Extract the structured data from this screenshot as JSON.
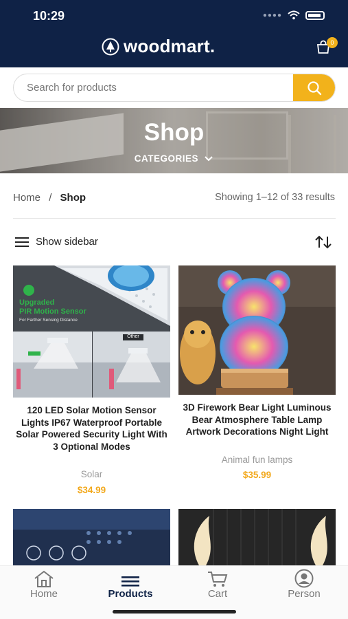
{
  "status": {
    "time": "10:29"
  },
  "brand": {
    "name": "woodmart.",
    "accent": "#f2b21b",
    "primary": "#0f2246"
  },
  "cart": {
    "count": "0"
  },
  "search": {
    "placeholder": "Search for products"
  },
  "banner": {
    "title": "Shop",
    "categories_label": "CATEGORIES"
  },
  "breadcrumb": {
    "home": "Home",
    "separator": "/",
    "current": "Shop"
  },
  "results_text": "Showing 1–12 of 33 results",
  "toolbar": {
    "show_sidebar": "Show sidebar"
  },
  "products": [
    {
      "title": "120 LED Solar Motion Sensor Lights IP67 Waterproof Portable Solar Powered Security Light With 3 Optional Modes",
      "category": "Solar",
      "price": "$34.99",
      "image_text": {
        "line1": "Upgraded",
        "line2": "PIR Motion Sensor",
        "line3": "For Farther Sensing Distance",
        "tag": "Other"
      }
    },
    {
      "title": "3D Firework Bear Light Luminous Bear Atmosphere Table Lamp Artwork Decorations Night Light",
      "category": "Animal fun lamps",
      "price": "$35.99"
    }
  ],
  "tabs": [
    {
      "label": "Home",
      "icon": "home-icon"
    },
    {
      "label": "Products",
      "icon": "menu-icon"
    },
    {
      "label": "Cart",
      "icon": "cart-icon"
    },
    {
      "label": "Person",
      "icon": "person-icon"
    }
  ]
}
